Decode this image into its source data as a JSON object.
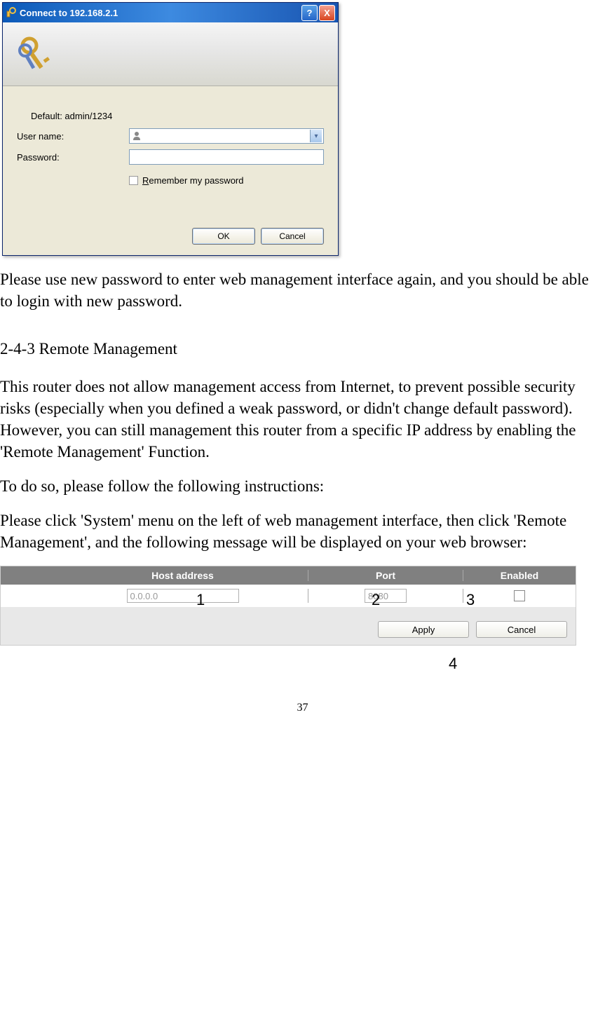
{
  "dialog": {
    "title": "Connect to 192.168.2.1",
    "help_symbol": "?",
    "close_symbol": "X",
    "hint": "Default: admin/1234",
    "username_label": "User name:",
    "password_label": "Password:",
    "remember_label": "Remember my password",
    "ok_label": "OK",
    "cancel_label": "Cancel"
  },
  "paragraphs": {
    "p1": "Please use new password to enter web management interface again, and you should be able to login with new password.",
    "heading": "2-4-3 Remote Management",
    "p2": "This router does not allow management access from Internet, to prevent possible security risks (especially when you defined a weak password, or didn't change default password). However, you can still management this router from a specific IP address by enabling the 'Remote Management' Function.",
    "p3": "To do so, please follow the following instructions:",
    "p4": "Please click 'System' menu on the left of web management interface, then click 'Remote Management', and the following message will be displayed on your web browser:"
  },
  "router": {
    "headers": {
      "blank": "",
      "host": "Host address",
      "port": "Port",
      "enabled": "Enabled"
    },
    "values": {
      "host": "0.0.0.0",
      "port": "8080"
    },
    "buttons": {
      "apply": "Apply",
      "cancel": "Cancel"
    },
    "callouts": {
      "c1": "1",
      "c2": "2",
      "c3": "3",
      "c4": "4"
    }
  },
  "page_number": "37"
}
